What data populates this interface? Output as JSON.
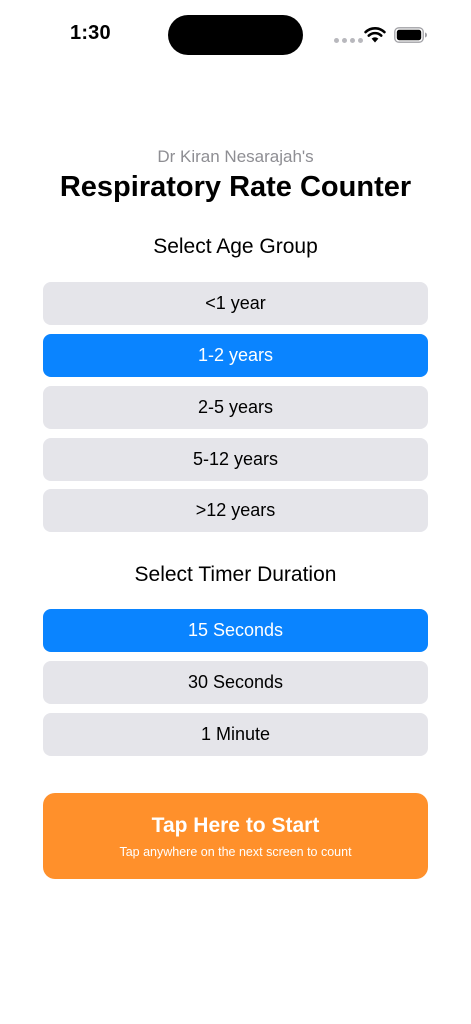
{
  "status_bar": {
    "time": "1:30"
  },
  "header": {
    "subtitle": "Dr Kiran Nesarajah's",
    "title": "Respiratory Rate Counter"
  },
  "age_group": {
    "heading": "Select Age Group",
    "options": [
      {
        "label": "<1 year",
        "selected": false
      },
      {
        "label": "1-2 years",
        "selected": true
      },
      {
        "label": "2-5 years",
        "selected": false
      },
      {
        "label": "5-12 years",
        "selected": false
      },
      {
        "label": ">12 years",
        "selected": false
      }
    ]
  },
  "timer": {
    "heading": "Select Timer Duration",
    "options": [
      {
        "label": "15 Seconds",
        "selected": true
      },
      {
        "label": "30 Seconds",
        "selected": false
      },
      {
        "label": "1 Minute",
        "selected": false
      }
    ]
  },
  "start": {
    "label": "Tap Here to Start",
    "hint": "Tap anywhere on the next screen to count"
  },
  "colors": {
    "selected": "#0a84ff",
    "unselected": "#e5e5ea",
    "start": "#ff902b",
    "subtitle": "#8e8e93"
  },
  "icons": [
    "signal-icon",
    "wifi-icon",
    "battery-icon"
  ]
}
